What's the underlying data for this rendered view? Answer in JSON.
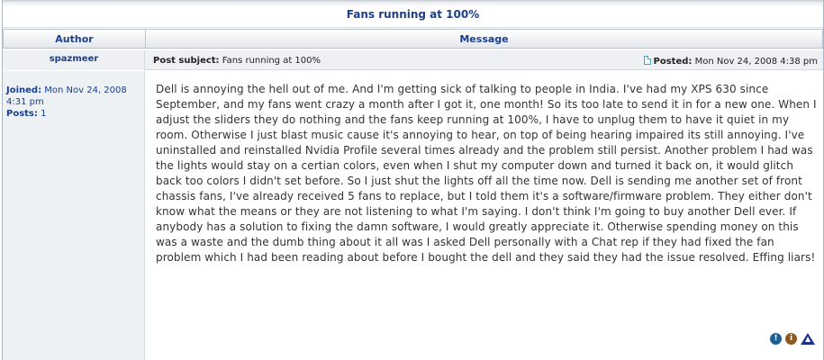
{
  "topic": {
    "title": "Fans running at 100%"
  },
  "columns": {
    "author": "Author",
    "message": "Message"
  },
  "post": {
    "author": "spazmeer",
    "joined_label": "Joined:",
    "joined_value": "Mon Nov 24, 2008 4:31 pm",
    "posts_label": "Posts:",
    "posts_value": "1",
    "subject_label": "Post subject:",
    "subject_value": "Fans running at 100%",
    "posted_label": "Posted:",
    "posted_value": "Mon Nov 24, 2008 4:38 pm",
    "body": "Dell is annoying the hell out of me. And I'm getting sick of talking to people in India. I've had my XPS 630 since September, and my fans went crazy a month after I got it, one month! So its too late to send it in for a new one. When I adjust the sliders they do nothing and the fans keep running at 100%, I have to unplug them to have it quiet in my room. Otherwise I just blast music cause it's annoying to hear, on top of being hearing impaired its still annoying. I've uninstalled and reinstalled Nvidia Profile several times already and the problem still persist. Another problem I had was the lights would stay on a certian colors, even when I shut my computer down and turned it back on, it would glitch back too colors I didn't set before. So I just shut the lights off all the time now. Dell is sending me another set of front chassis fans, I've already received 5 fans to replace, but I told them it's a software/firmware problem. They either don't know what the means or they are not listening to what I'm saying. I don't think I'm going to buy another Dell ever. If anybody has a solution to fixing the damn software, I would greatly appreciate it. Otherwise spending money on this was a waste and the dumb thing about it all was I asked Dell personally with a Chat rep if they had fixed the fan problem which I had been reading about before I bought the dell and they said they had the issue resolved. Effing liars!"
  },
  "icons": {
    "report": "report-icon",
    "info": "info-icon",
    "top": "top-icon"
  },
  "colors": {
    "link": "#1b3f8b",
    "row_bg": "#eef1f4",
    "report": "#1d5f93",
    "info": "#8a5a1f",
    "top": "#1a2f8c"
  }
}
